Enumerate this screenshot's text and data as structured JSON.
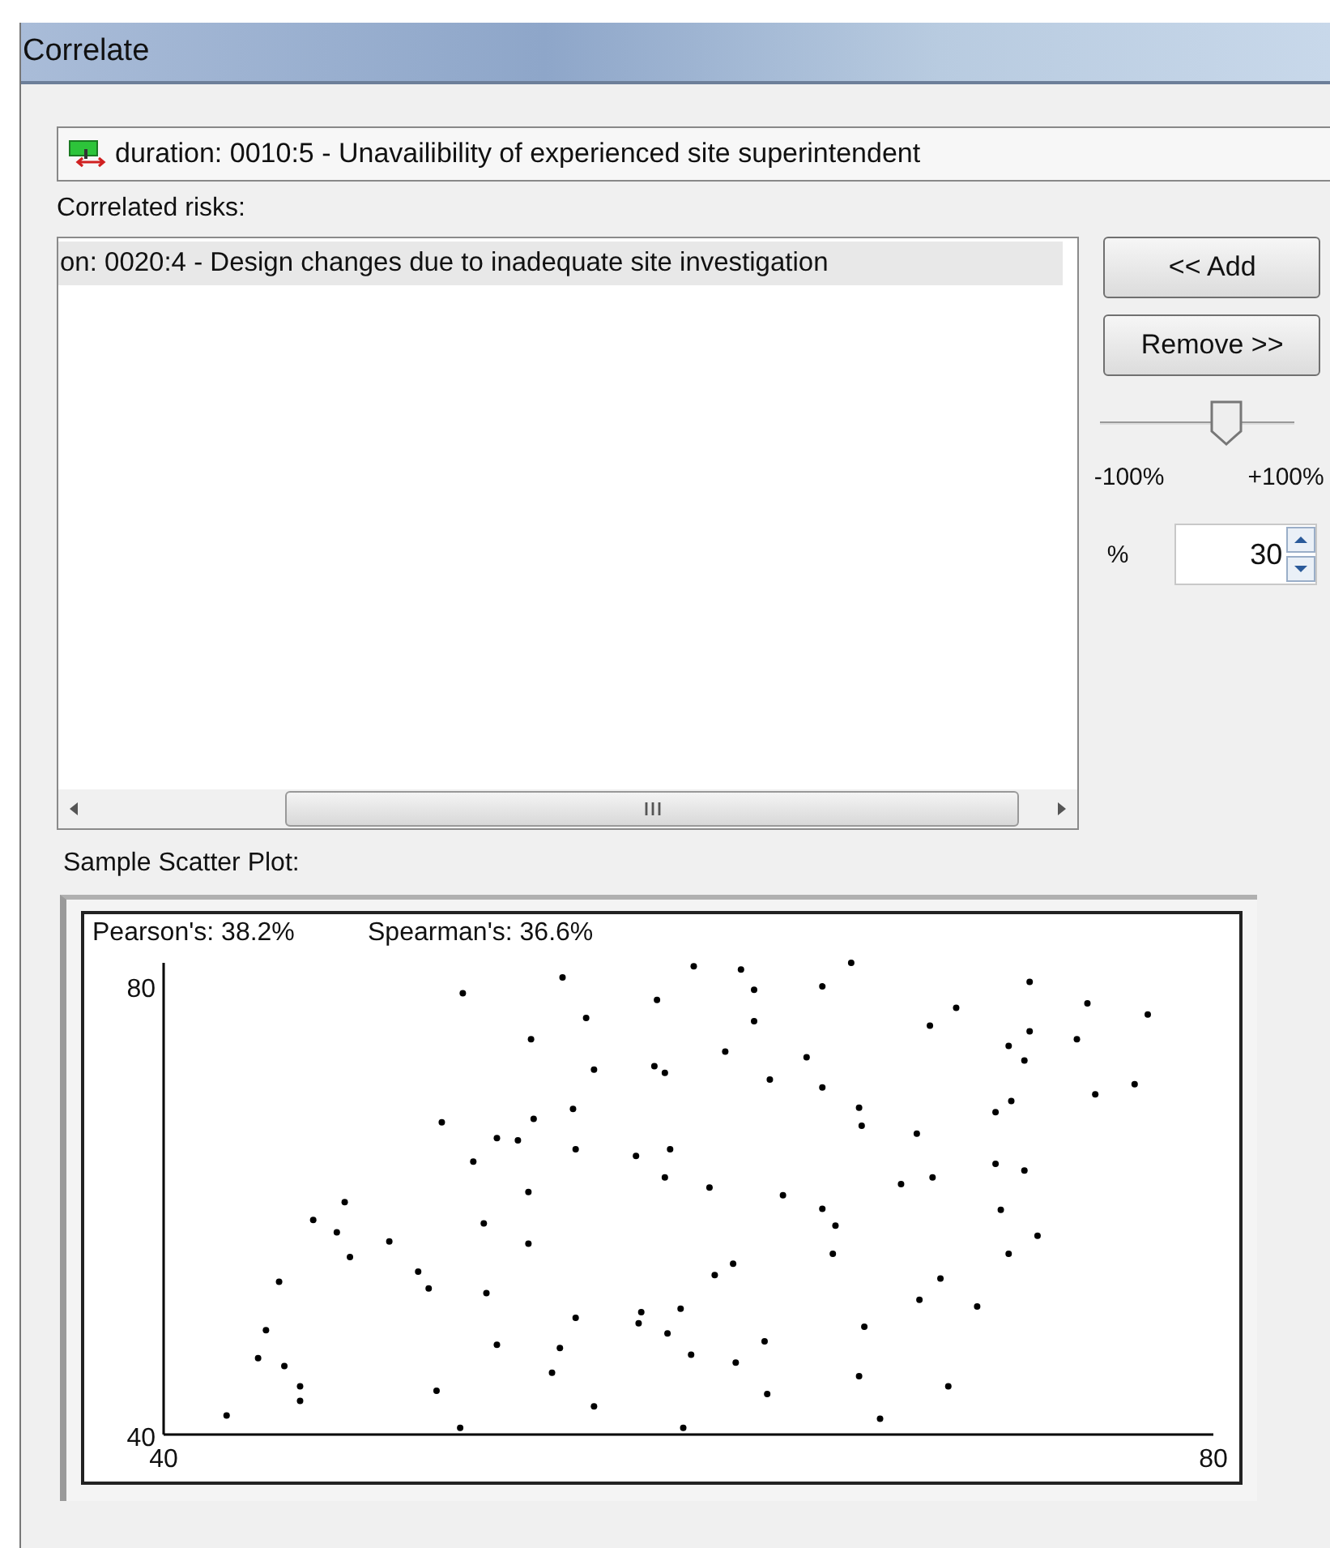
{
  "window": {
    "title": "Correlate"
  },
  "source_risk": {
    "text": "duration: 0010:5 - Unavailibility of experienced site superintendent"
  },
  "correlated_risks": {
    "label": "Correlated risks:",
    "items": [
      {
        "text": "on: 0020:4 - Design changes due to inadequate site investigation",
        "selected": true
      }
    ]
  },
  "buttons": [
    {
      "label": "<< Add"
    },
    {
      "label": "Remove >>"
    }
  ],
  "correlation": {
    "level": 0.65,
    "min_label": "-100%",
    "max_label": "+100%",
    "unit": "%",
    "value": "30"
  },
  "scatter": {
    "label": "Sample Scatter Plot:",
    "chart_data": {
      "type": "scatter",
      "annotations": [
        "Pearson's: 38.2%",
        "Spearman's: 36.6%"
      ],
      "xlim": [
        40,
        80
      ],
      "ylim": [
        40,
        82
      ],
      "xticks": [
        40,
        80
      ],
      "yticks": [
        40,
        80
      ],
      "x": [
        51.4,
        55.2,
        60.2,
        58.8,
        56.1,
        54.0,
        56.4,
        58.7,
        59.1,
        50.6,
        54.1,
        55.6,
        52.7,
        53.5,
        55.7,
        58.0,
        59.3,
        51.8,
        59.1,
        53.9,
        46.9,
        45.7,
        52.2,
        46.6,
        53.9,
        48.6,
        47.1,
        49.7,
        50.1,
        44.4,
        52.3,
        55.7,
        58.2,
        58.1,
        59.7,
        59.2,
        43.9,
        52.7,
        55.1,
        60.1,
        43.6,
        44.6,
        54.8,
        45.2,
        50.4,
        45.2,
        56.4,
        42.4,
        51.3,
        59.8,
        62.0,
        66.2,
        62.5,
        65.1,
        73.0,
        62.5,
        70.2,
        69.2,
        75.2,
        77.5,
        73.0,
        72.2,
        74.8,
        61.4,
        64.5,
        72.8,
        63.1,
        65.1,
        75.5,
        77.0,
        66.5,
        72.3,
        71.7,
        66.6,
        68.7,
        60.8,
        71.7,
        72.8,
        68.1,
        69.3,
        63.6,
        65.1,
        65.6,
        71.9,
        73.3,
        65.5,
        72.2,
        61.7,
        61.0,
        69.6,
        68.8,
        71.0,
        62.9,
        66.7,
        61.8,
        66.5,
        69.9,
        63.0,
        67.3
      ],
      "series": [
        {
          "color": "#000000",
          "values": [
            79.3,
            80.7,
            81.7,
            78.7,
            77.1,
            75.2,
            72.5,
            72.8,
            72.2,
            67.8,
            68.1,
            69.0,
            66.4,
            66.2,
            65.4,
            64.8,
            65.4,
            64.3,
            62.9,
            61.6,
            60.7,
            59.1,
            58.8,
            58.0,
            57.0,
            57.2,
            55.8,
            54.5,
            53.0,
            53.6,
            52.6,
            50.4,
            50.9,
            49.9,
            51.2,
            49.0,
            49.3,
            48.0,
            47.7,
            47.1,
            46.8,
            46.1,
            45.5,
            44.3,
            43.9,
            43.0,
            42.5,
            41.7,
            40.6,
            40.6,
            81.4,
            82.0,
            79.6,
            79.9,
            80.3,
            76.8,
            78.0,
            76.4,
            78.4,
            77.4,
            75.9,
            74.6,
            75.2,
            74.1,
            73.6,
            73.3,
            71.6,
            70.9,
            70.3,
            71.2,
            69.1,
            69.7,
            68.7,
            67.5,
            66.8,
            62.0,
            64.1,
            63.5,
            62.3,
            62.9,
            61.3,
            60.1,
            58.6,
            60.0,
            57.7,
            56.1,
            56.1,
            55.2,
            54.2,
            53.9,
            52.0,
            51.4,
            48.3,
            49.6,
            46.4,
            45.2,
            44.3,
            43.6,
            41.4
          ]
        }
      ]
    }
  }
}
